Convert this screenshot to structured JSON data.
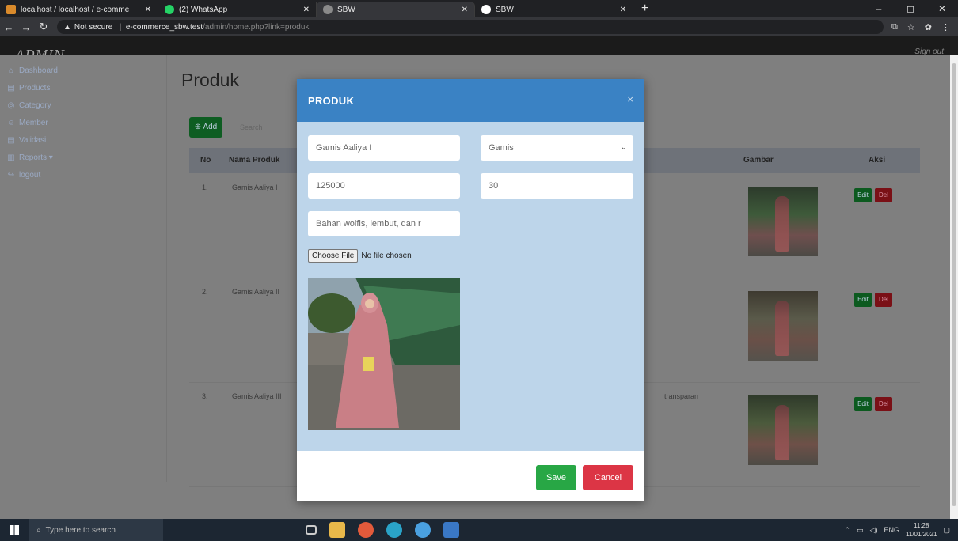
{
  "browser": {
    "tabs": [
      {
        "title": "localhost / localhost / e-comme",
        "color": "#d98a2b"
      },
      {
        "title": "(2) WhatsApp",
        "color": "#25d366"
      },
      {
        "title": "SBW",
        "color": "#8a8a8a"
      },
      {
        "title": "SBW",
        "color": "#ffffff"
      }
    ],
    "new_tab": "+",
    "window_controls": [
      "–",
      "◻",
      "✕"
    ],
    "not_secure": "Not secure",
    "url_host": "e-commerce_sbw.test",
    "url_path": "/admin/home.php?link=produk"
  },
  "app": {
    "logo": "ADMIN",
    "top_right": "Sign out",
    "page_title": "Produk",
    "sidebar": [
      {
        "icon": "⌂",
        "label": "Dashboard"
      },
      {
        "icon": "▤",
        "label": "Products"
      },
      {
        "icon": "◎",
        "label": "Category"
      },
      {
        "icon": "☺",
        "label": "Member"
      },
      {
        "icon": "▤",
        "label": "Validasi"
      },
      {
        "icon": "▥",
        "label": "Reports ▾"
      },
      {
        "icon": "↪",
        "label": "logout"
      }
    ],
    "add_label": "⊕ Add",
    "search_placeholder": "Search",
    "table": {
      "headers": [
        "No",
        "Nama Produk",
        "Gambar",
        "Aksi"
      ],
      "rows": [
        {
          "no": "1.",
          "name": "Gamis Aaliya I",
          "desc": ""
        },
        {
          "no": "2.",
          "name": "Gamis Aaliya II",
          "desc": ""
        },
        {
          "no": "3.",
          "name": "Gamis Aaliya III",
          "desc": "transparan"
        }
      ],
      "edit_label": "Edit",
      "del_label": "Del"
    }
  },
  "modal": {
    "title": "PRODUK",
    "close": "×",
    "name_value": "Gamis Aaliya I",
    "category_value": "Gamis",
    "price_value": "125000",
    "stock_value": "30",
    "description_value": "Bahan wolfis, lembut, dan r",
    "file_button": "Choose File",
    "file_status": "No file chosen",
    "save_label": "Save",
    "cancel_label": "Cancel"
  },
  "taskbar": {
    "search_placeholder": "Type here to search",
    "lang": "ENG",
    "time": "11:28",
    "date": "11/01/2021"
  }
}
